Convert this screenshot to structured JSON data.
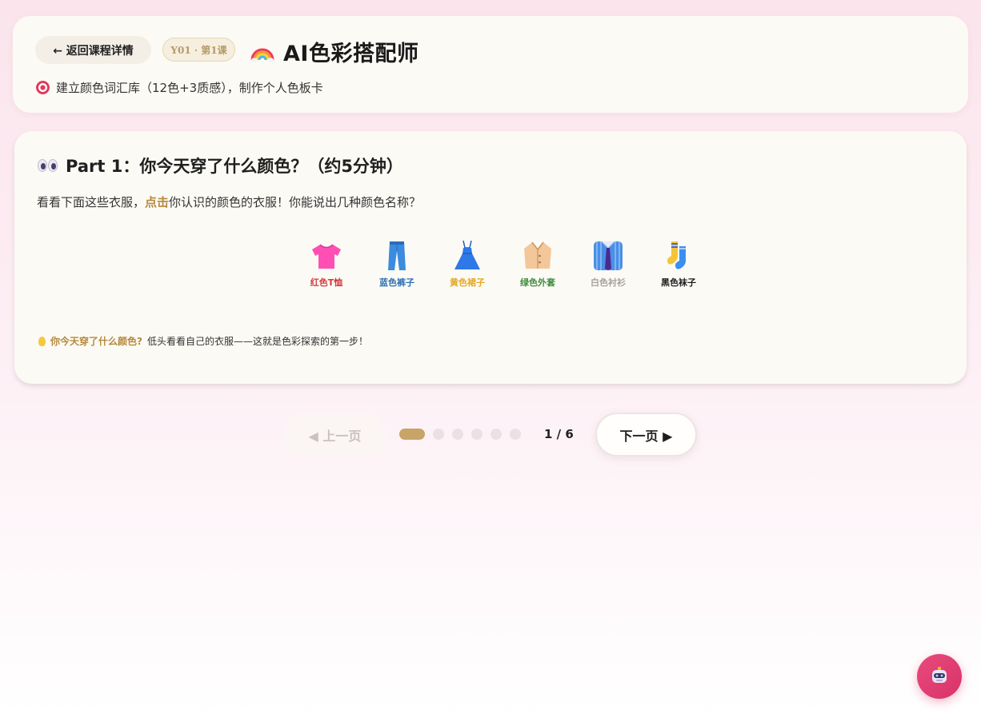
{
  "header": {
    "back_label": "← 返回课程详情",
    "lesson_badge": "Y01 · 第1课",
    "title": "AI色彩搭配师",
    "subtitle": "建立颜色词汇库（12色+3质感），制作个人色板卡"
  },
  "part": {
    "title": "Part 1：你今天穿了什么颜色？（约5分钟）",
    "instruction_before": "看看下面这些衣服，",
    "instruction_highlight": "点击",
    "instruction_after": "你认识的颜色的衣服！你能说出几种颜色名称？",
    "clothes": [
      {
        "label": "红色T恤",
        "icon": "t-shirt-icon",
        "color": "#d2383f"
      },
      {
        "label": "蓝色裤子",
        "icon": "jeans-icon",
        "color": "#2f6fb3"
      },
      {
        "label": "黄色裙子",
        "icon": "dress-icon",
        "color": "#e5a824"
      },
      {
        "label": "绿色外套",
        "icon": "coat-icon",
        "color": "#3f8a3c"
      },
      {
        "label": "白色衬衫",
        "icon": "shirt-icon",
        "color": "#a5a0a0"
      },
      {
        "label": "黑色袜子",
        "icon": "socks-icon",
        "color": "#1e1e1e"
      }
    ],
    "tip_strong": "你今天穿了什么颜色?",
    "tip_text": "低头看看自己的衣服——这就是色彩探索的第一步！"
  },
  "pager": {
    "prev_label": "◀ 上一页",
    "next_label": "下一页 ▶",
    "indicator": "1 / 6",
    "total_pages": 6,
    "current_page": 1
  },
  "colors": {
    "accent": "#c9a468",
    "background_top": "#fbe4ec",
    "robot_button": "#e84a7c"
  },
  "floating": {
    "icon": "robot-icon"
  }
}
